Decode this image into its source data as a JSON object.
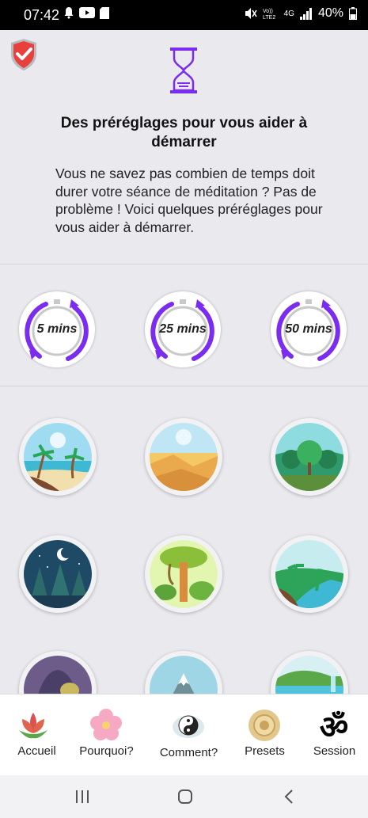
{
  "status_bar": {
    "time": "07:42",
    "network": "4G",
    "battery": "40%"
  },
  "header": {
    "title": "Des préréglages pour vous aider à démarrer",
    "intro": "Vous ne savez pas combien de temps doit durer votre séance de méditation ? Pas de problème ! Voici quelques préréglages pour vous aider à démarrer."
  },
  "presets": [
    {
      "label": "5 mins"
    },
    {
      "label": "25 mins"
    },
    {
      "label": "50 mins"
    }
  ],
  "scenes": [
    "beach-palms",
    "desert-dunes",
    "forest",
    "night-forest",
    "jungle-tree",
    "tropical-river",
    "cave",
    "mountain",
    "waterfall"
  ],
  "tabs": [
    {
      "label": "Accueil",
      "icon": "lotus-icon"
    },
    {
      "label": "Pourquoi?",
      "icon": "flower-icon"
    },
    {
      "label": "Comment?",
      "icon": "yin-yang-icon"
    },
    {
      "label": "Presets",
      "icon": "sun-mandala-icon"
    },
    {
      "label": "Session",
      "icon": "om-icon"
    }
  ],
  "colors": {
    "accent": "#7b2cf0",
    "background": "#e9e9ee"
  }
}
